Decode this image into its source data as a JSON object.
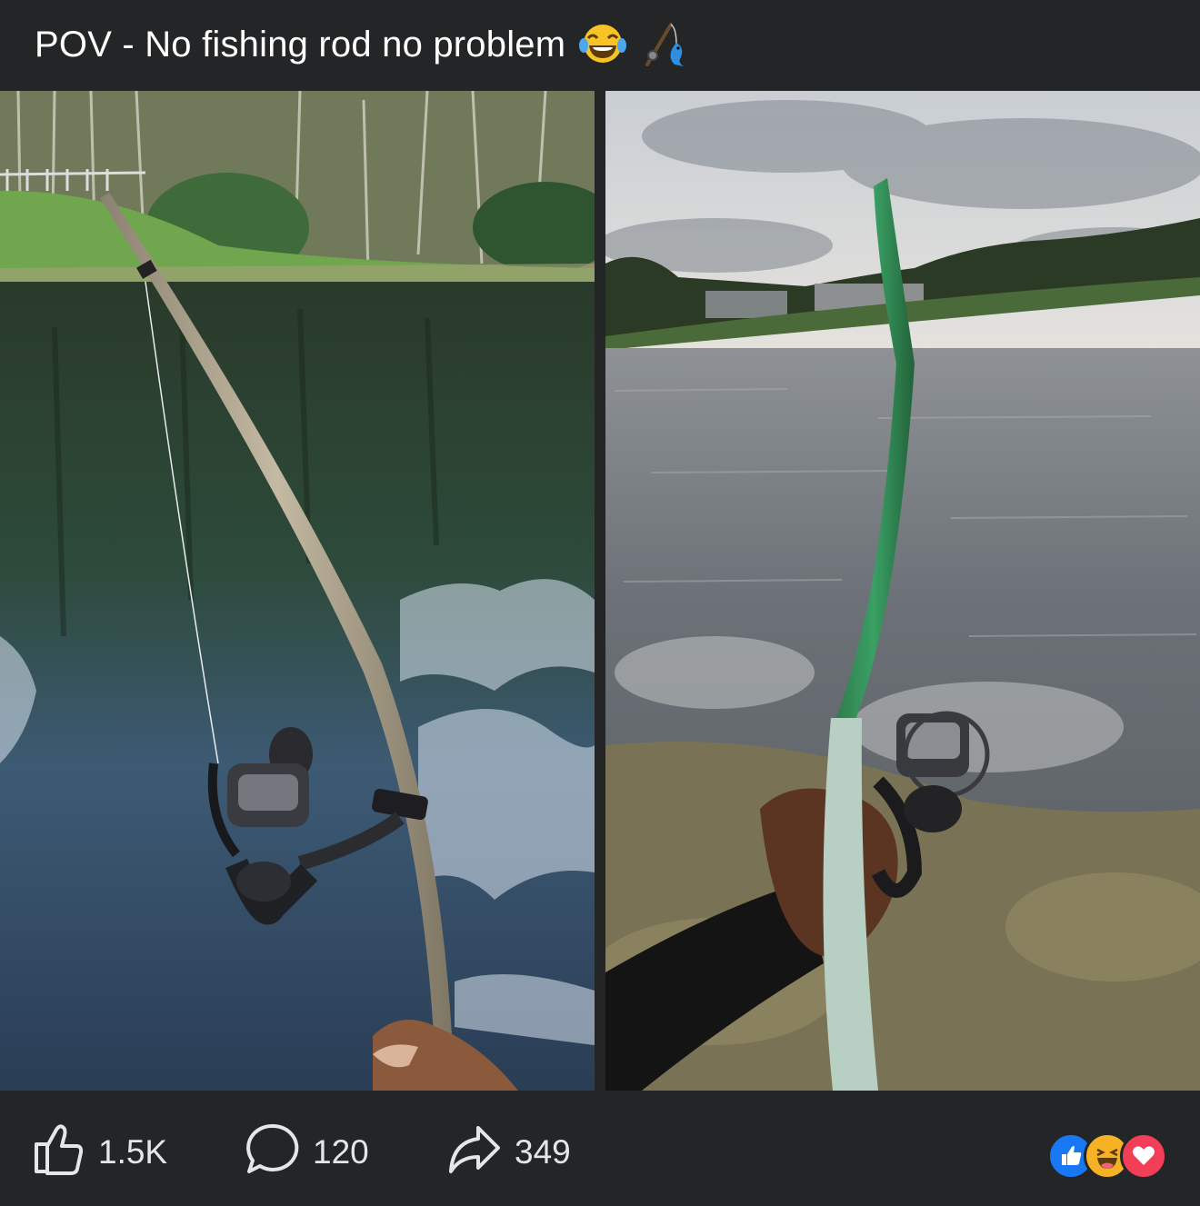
{
  "post": {
    "title": "POV - No fishing rod no problem",
    "title_emojis": [
      "laughing-tears-emoji",
      "fishing-pole-emoji"
    ]
  },
  "photos": [
    {
      "name": "stick-rod-pond-photo"
    },
    {
      "name": "taped-stick-rod-lake-photo"
    }
  ],
  "actions": {
    "like_icon": "thumbs-up-icon",
    "like_count": "1.5K",
    "comment_icon": "comment-bubble-icon",
    "comment_count": "120",
    "share_icon": "share-arrow-icon",
    "share_count": "349"
  },
  "reactions": [
    "like-reaction-icon",
    "haha-reaction-icon",
    "love-reaction-icon"
  ],
  "colors": {
    "background": "#242526",
    "text": "#e4e6eb",
    "like_blue": "#1877f2",
    "love_red": "#f33e58",
    "haha_yellow": "#f7b125"
  }
}
